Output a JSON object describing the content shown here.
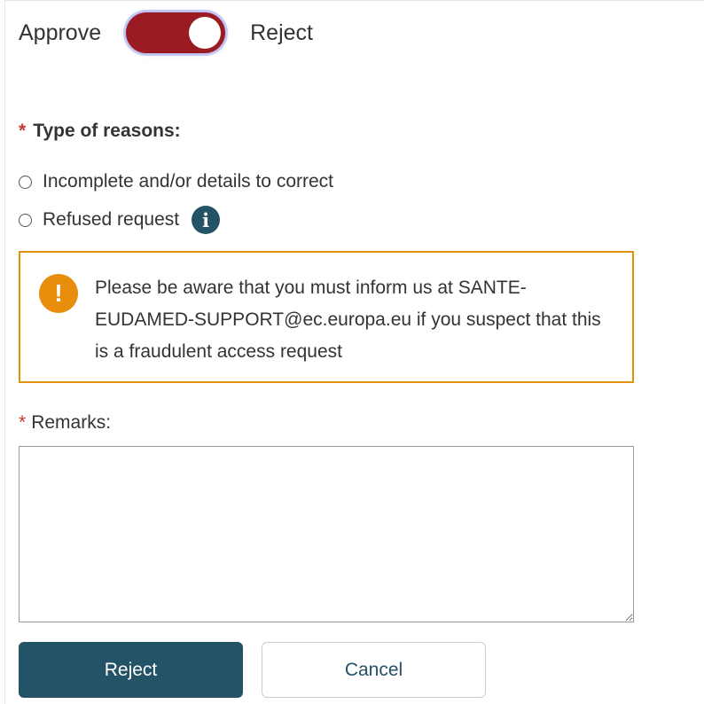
{
  "toggle": {
    "left_label": "Approve",
    "right_label": "Reject",
    "state": "Reject",
    "color": "#9a1b22"
  },
  "reasons": {
    "required_marker": "*",
    "title": "Type of reasons:",
    "options": [
      {
        "label": "Incomplete and/or details to correct",
        "selected": false
      },
      {
        "label": "Refused request",
        "selected": false,
        "icon": "info-icon"
      }
    ]
  },
  "warning": {
    "icon": "exclamation-icon",
    "text": "Please be aware that you must inform us at SANTE-EUDAMED-SUPPORT@ec.europa.eu if you suspect that this is a fraudulent access request",
    "border_color": "#e3900b"
  },
  "remarks": {
    "required_marker": "*",
    "label": "Remarks:",
    "value": ""
  },
  "buttons": {
    "reject_label": "Reject",
    "cancel_label": "Cancel",
    "primary_color": "#245266"
  }
}
